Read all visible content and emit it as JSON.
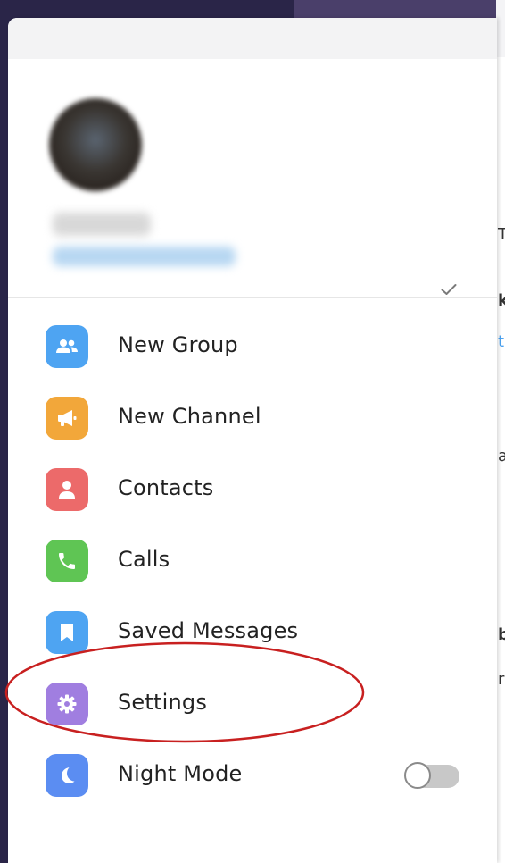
{
  "profile": {
    "name": "",
    "username": ""
  },
  "menu": {
    "items": [
      {
        "label": "New Group",
        "icon": "group-icon",
        "color": "#4ea4f2"
      },
      {
        "label": "New Channel",
        "icon": "megaphone-icon",
        "color": "#f2a73a"
      },
      {
        "label": "Contacts",
        "icon": "person-icon",
        "color": "#ec6a6a"
      },
      {
        "label": "Calls",
        "icon": "phone-icon",
        "color": "#5fc554"
      },
      {
        "label": "Saved Messages",
        "icon": "bookmark-icon",
        "color": "#4ea4f2"
      },
      {
        "label": "Settings",
        "icon": "gear-icon",
        "color": "#a07ee0"
      },
      {
        "label": "Night Mode",
        "icon": "moon-icon",
        "color": "#5b8df2"
      }
    ]
  },
  "night_mode": {
    "enabled": false
  },
  "colors": {
    "annotation": "#c82020",
    "divider": "#e6e6e6"
  }
}
